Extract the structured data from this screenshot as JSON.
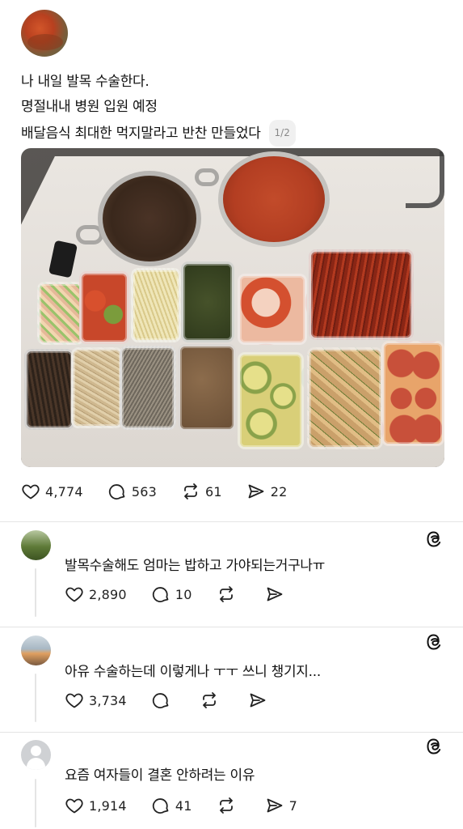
{
  "post": {
    "lines": [
      "나 내일 발목 수술한다.",
      "명절내내 병원 입원 예정",
      "배달음식 최대한 먹지말라고 반찬 만들었다"
    ],
    "page_indicator": "1/2",
    "stats": {
      "likes": "4,774",
      "replies": "563",
      "reposts": "61",
      "shares": "22"
    }
  },
  "comments": [
    {
      "text": "발목수술해도 엄마는 밥하고 가야되는거구나ㅠ",
      "likes": "2,890",
      "replies": "10",
      "reposts": "",
      "shares": ""
    },
    {
      "text": "아유 수술하는데 이렇게나 ㅜㅜ 쓰니 챙기지...",
      "likes": "3,734",
      "replies": "",
      "reposts": "",
      "shares": ""
    },
    {
      "text": "요즘 여자들이 결혼 안하려는 이유",
      "likes": "1,914",
      "replies": "41",
      "reposts": "",
      "shares": "7"
    }
  ],
  "icons": {
    "like": "heart-icon",
    "reply": "comment-icon",
    "repost": "repost-icon",
    "share": "send-icon",
    "threads": "threads-logo-icon"
  }
}
